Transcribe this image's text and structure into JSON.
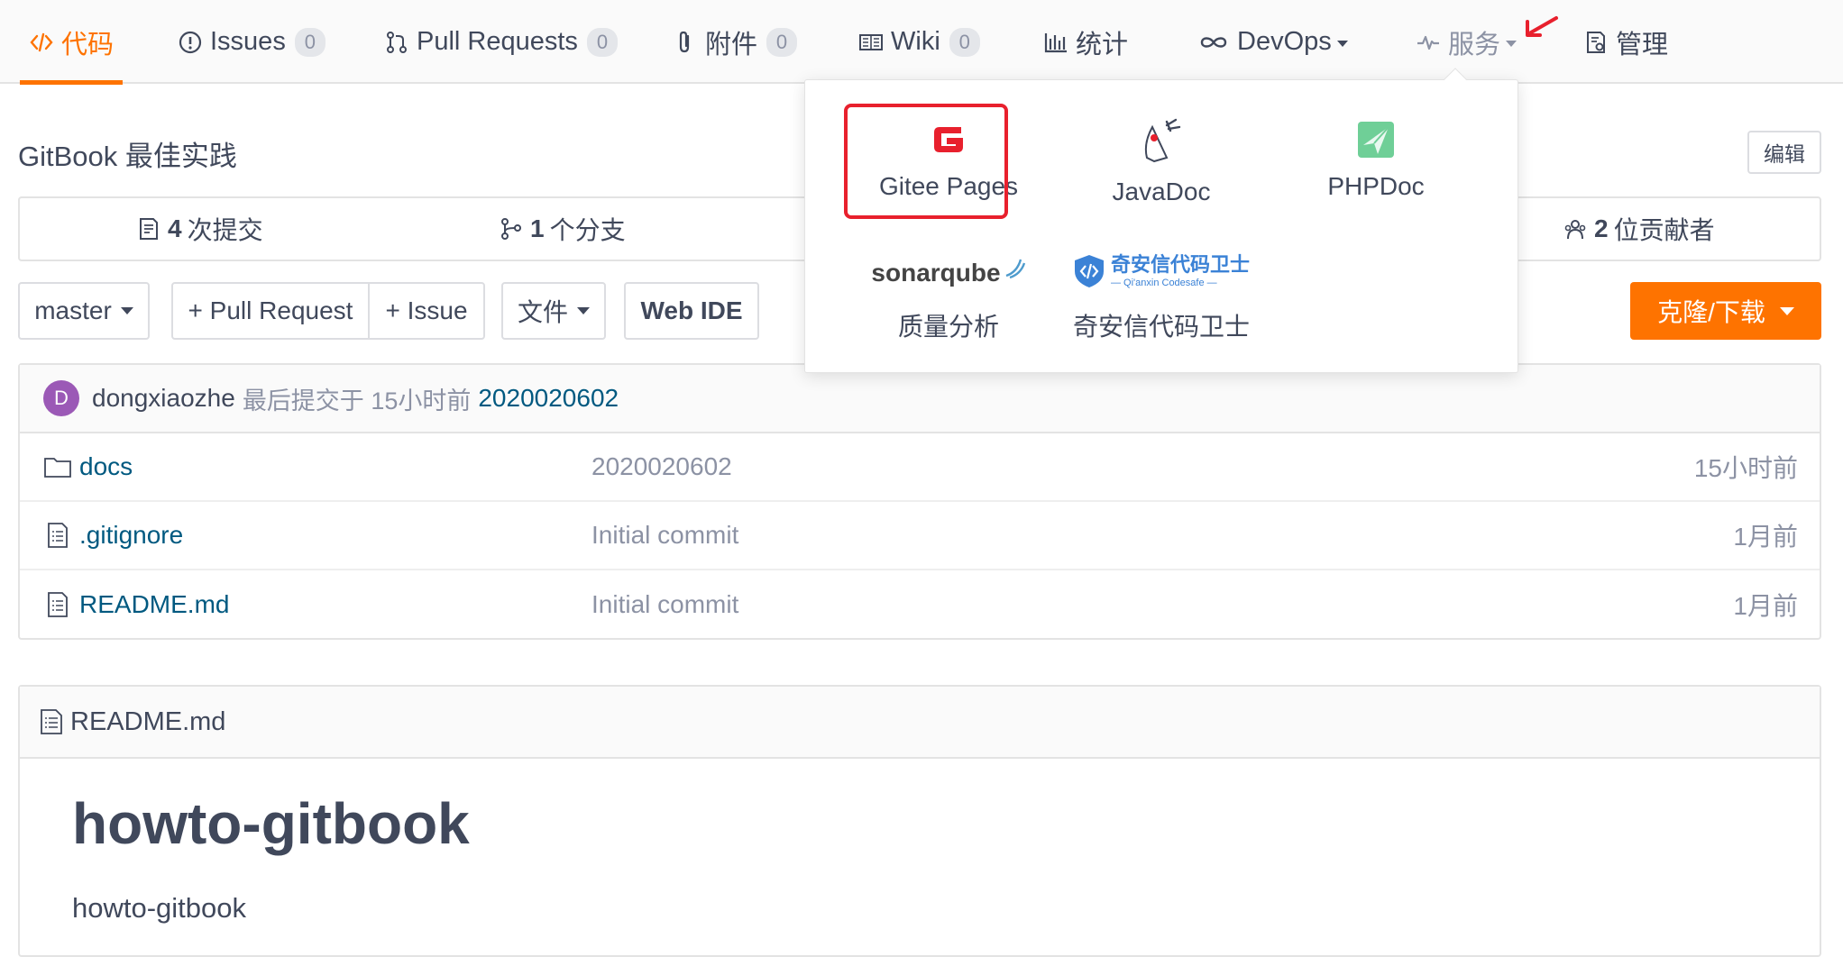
{
  "nav": {
    "code": "代码",
    "issues": "Issues",
    "issues_count": "0",
    "pulls": "Pull Requests",
    "pulls_count": "0",
    "attachments": "附件",
    "attachments_count": "0",
    "wiki": "Wiki",
    "wiki_count": "0",
    "stats": "统计",
    "devops": "DevOps",
    "services": "服务",
    "manage": "管理"
  },
  "repo": {
    "title": "GitBook 最佳实践",
    "edit": "编辑"
  },
  "stats": {
    "commits_n": "4",
    "commits_label": "次提交",
    "branches_n": "1",
    "branches_label": "个分支",
    "contributors_n": "2",
    "contributors_label": "位贡献者"
  },
  "toolbar": {
    "branch": "master",
    "new_pr": "+ Pull Request",
    "new_issue": "+ Issue",
    "file_menu": "文件",
    "web_ide": "Web IDE",
    "clone": "克隆/下载"
  },
  "last_commit": {
    "avatar_letter": "D",
    "author": "dongxiaozhe",
    "meta": "最后提交于 15小时前",
    "hash": "2020020602"
  },
  "files": [
    {
      "name": "docs",
      "message": "2020020602",
      "time": "15小时前"
    },
    {
      "name": ".gitignore",
      "message": "Initial commit",
      "time": "1月前"
    },
    {
      "name": "README.md",
      "message": "Initial commit",
      "time": "1月前"
    }
  ],
  "readme": {
    "filename": "README.md",
    "heading": "howto-gitbook",
    "body": "howto-gitbook"
  },
  "services_menu": {
    "items": [
      {
        "label": "Gitee Pages",
        "icon": "gitee-pages-logo"
      },
      {
        "label": "JavaDoc",
        "icon": "javadoc-duke-logo"
      },
      {
        "label": "PHPDoc",
        "icon": "phpdoc-logo"
      },
      {
        "label": "质量分析",
        "icon": "sonarqube-logo",
        "logo_text": "sonarqube"
      },
      {
        "label": "奇安信代码卫士",
        "icon": "qianxin-codesafe-logo",
        "logo_text": "奇安信代码卫士",
        "logo_subtext": "— Qi'anxin Codesafe —"
      }
    ]
  },
  "colors": {
    "accent": "#fe7300",
    "link": "#005980",
    "highlight_box": "#e8202d"
  }
}
